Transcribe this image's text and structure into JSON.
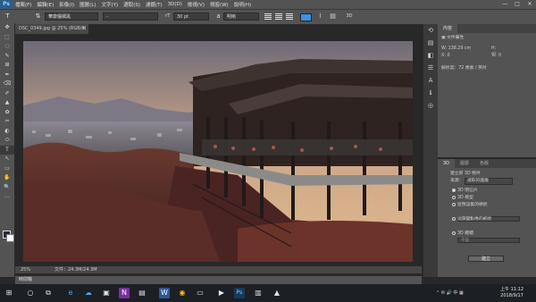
{
  "app": {
    "logo": "Ps"
  },
  "menu": {
    "items": [
      "檔案(F)",
      "編輯(E)",
      "影像(I)",
      "圖層(L)",
      "文字(Y)",
      "選取(S)",
      "濾鏡(T)",
      "3D(D)",
      "檢視(V)",
      "視窗(W)",
      "說明(H)"
    ]
  },
  "window_controls": {
    "minimize": "—",
    "maximize": "□",
    "close": "✕"
  },
  "options_bar": {
    "tool_glyph": "T",
    "orient_glyph": "⇅",
    "font_family": "華康儷細黑",
    "font_style": "-",
    "size_glyph": "ᴛT",
    "font_size": "30 pt",
    "aa_glyph": "a",
    "antialias": "明晰",
    "text_color": "#3d8fe6",
    "warp_glyph": "⌇",
    "panel_glyph": "▤",
    "threed_label": "3D"
  },
  "document": {
    "tab_title": "DSC_0349.jpg @ 25% (RGB/8)",
    "close": "×",
    "zoom": "25%",
    "file_info": "文件：24.3M/24.3M"
  },
  "tools": [
    "✥",
    "⬚",
    "◌",
    "✎",
    "⊞",
    "✒",
    "⌫",
    "✐",
    "▲",
    "✿",
    "✂",
    "◐",
    "⬭",
    "T",
    "↖",
    "▭",
    "✋",
    "🔍",
    "…"
  ],
  "swatches": {
    "fg": "#1f2b3f",
    "bg": "#ffffff"
  },
  "timeline_label": "時間軸",
  "midstrip_icons": [
    "⟲",
    "▤",
    "◧",
    "☰",
    "A",
    "ℹ",
    "◎"
  ],
  "properties_panel": {
    "tab": "內容",
    "type_label": "文件屬性",
    "w_label": "W:",
    "w_value": "138.29 cm",
    "h_label": "H:",
    "x_label": "X:",
    "x_value": "0",
    "y_label": "Y:",
    "y_value": "0",
    "link_glyph": "⛓",
    "resolution": "解析度：72 像素 / 英吋"
  },
  "threed_panel": {
    "tabs": [
      "3D",
      "圖層",
      "色版"
    ],
    "section_title": "建立新 3D 物件",
    "source_label": "來源：",
    "source_value": "選取的圖層",
    "options": [
      {
        "label": "3D 明信片",
        "selected": true
      },
      {
        "label": "3D 模型",
        "selected": false
      },
      {
        "label": "從預設集的網狀",
        "selected": false
      },
      {
        "label": "從深度對應的網狀",
        "selected": false
      },
      {
        "label": "3D 體積",
        "selected": false
      }
    ],
    "preset_placeholder": "甜甜圈",
    "depth_placeholder": "平面",
    "create_button": "建立"
  },
  "taskbar": {
    "start_glyph": "⊞",
    "apps": [
      {
        "glyph": "○",
        "color": "#e0e0e0",
        "bg": "transparent"
      },
      {
        "glyph": "⧉",
        "color": "#e0e0e0",
        "bg": "transparent"
      },
      {
        "glyph": "e",
        "color": "#4aa3ff",
        "bg": "transparent"
      },
      {
        "glyph": "☁",
        "color": "#5aa0ff",
        "bg": "transparent"
      },
      {
        "glyph": "▣",
        "color": "#e0e0e0",
        "bg": "transparent"
      },
      {
        "glyph": "N",
        "color": "#ffffff",
        "bg": "#7b2f9e"
      },
      {
        "glyph": "▤",
        "color": "#e0e0e0",
        "bg": "transparent"
      },
      {
        "glyph": "W",
        "color": "#ffffff",
        "bg": "#2b5797"
      },
      {
        "glyph": "◉",
        "color": "#f4c20d",
        "bg": "transparent"
      },
      {
        "glyph": "▭",
        "color": "#e0e0e0",
        "bg": "transparent"
      },
      {
        "glyph": "▶",
        "color": "#e8e8e8",
        "bg": "transparent"
      },
      {
        "glyph": "Ps",
        "color": "#8ec8ff",
        "bg": "#163a5a"
      },
      {
        "glyph": "▥",
        "color": "#e0e0e0",
        "bg": "transparent"
      },
      {
        "glyph": "▲",
        "color": "#e0e0e0",
        "bg": "transparent"
      }
    ],
    "tray_glyphs": "⌃  ✉  🔊  中  ▦",
    "time": "上午 11:12",
    "date": "2018/9/17"
  }
}
